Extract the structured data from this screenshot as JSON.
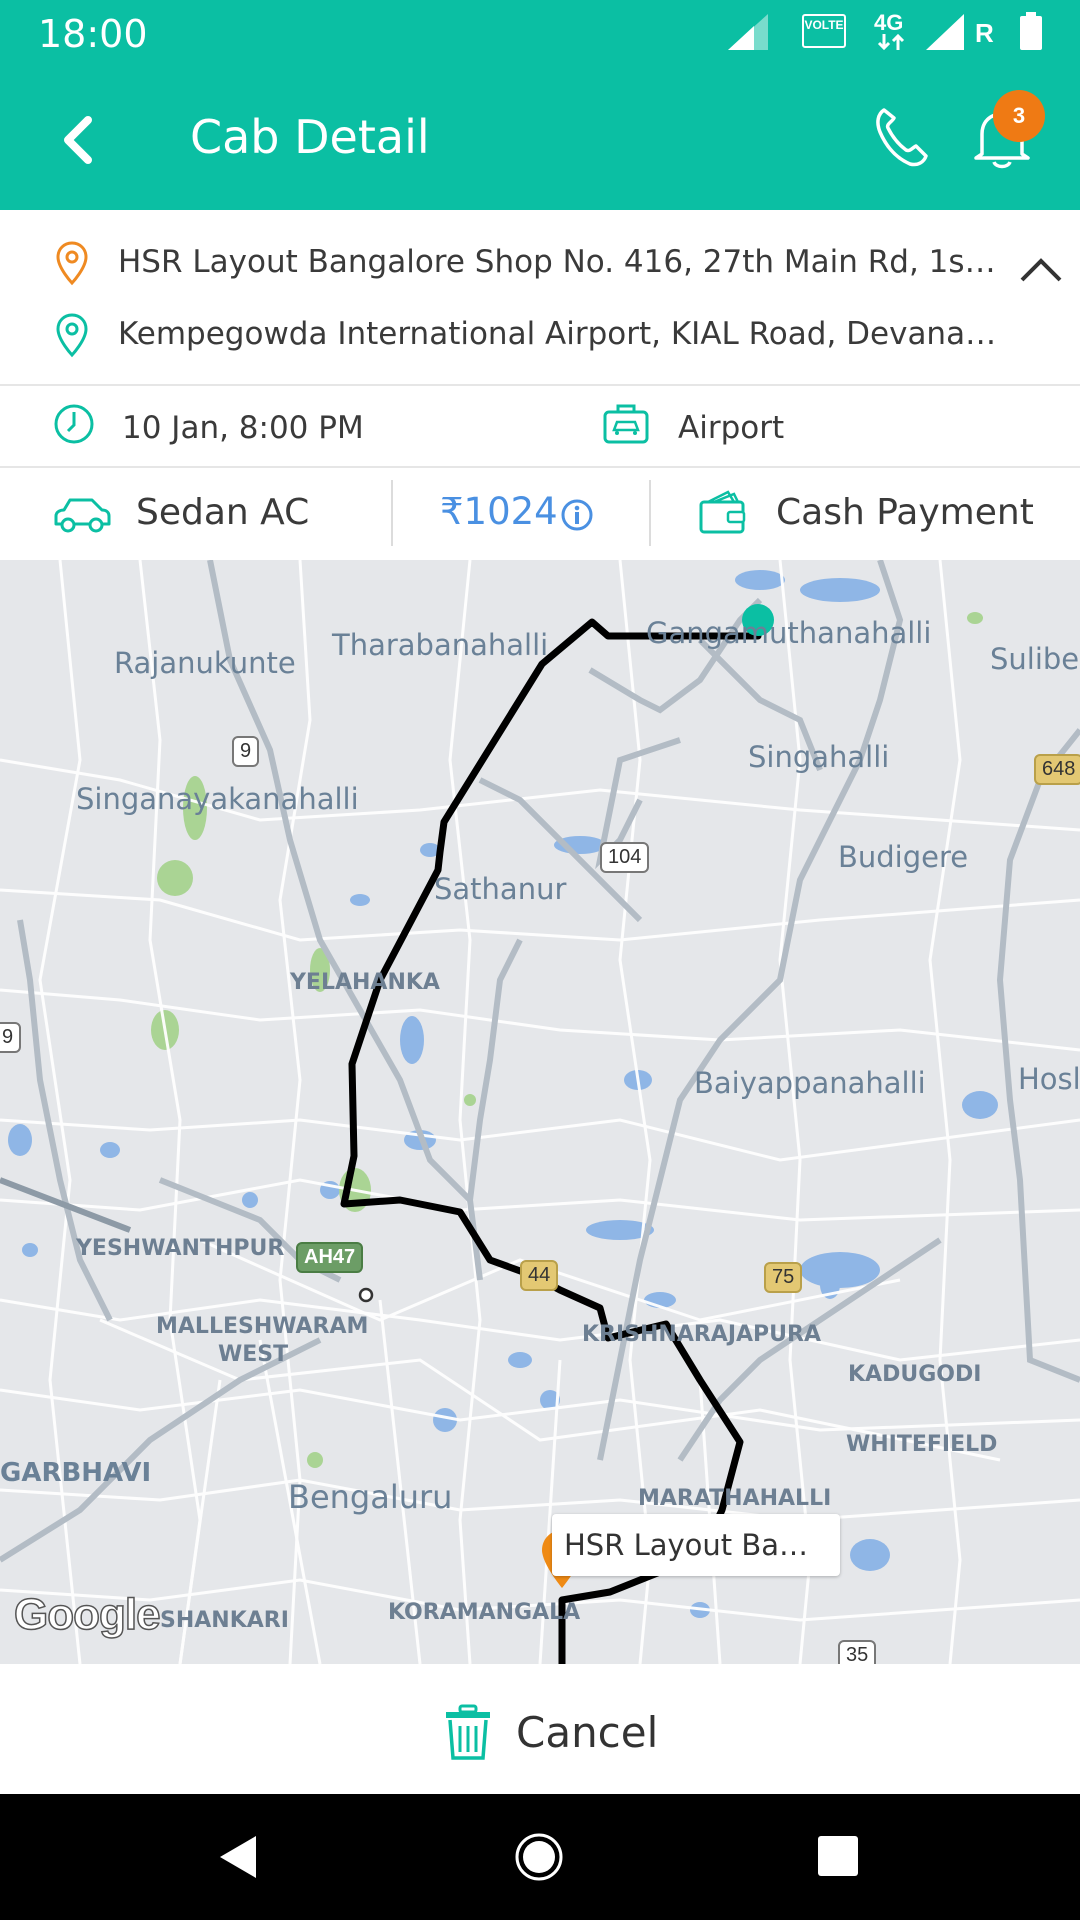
{
  "status_bar": {
    "time": "18:00",
    "volte_label": "VOLTE",
    "network_label": "4G",
    "roaming_label": "R"
  },
  "header": {
    "title": "Cab Detail",
    "notification_count": "3"
  },
  "addresses": {
    "pickup": "HSR Layout Bangalore Shop No. 416, 27th Main Rd, 1st…",
    "drop": "Kempegowda International Airport, KIAL Road, Devanaha…"
  },
  "trip": {
    "datetime": "10 Jan, 8:00 PM",
    "trip_type": "Airport"
  },
  "cab": {
    "type": "Sedan AC",
    "currency": "₹",
    "fare": "1024",
    "payment": "Cash Payment"
  },
  "map": {
    "places": [
      "Rajanukunte",
      "Tharabanahalli",
      "Gangamuthanahalli",
      "Sulibel",
      "Singahalli",
      "Singanayakanahalli",
      "Budigere",
      "Sathanur",
      "YELAHANKA",
      "Baiyappanahalli",
      "Hosl",
      "YESHWANTHPUR",
      "MALLESHWARAM",
      "WEST",
      "KRISHNARAJAPURA",
      "KADUGODI",
      "WHITEFIELD",
      "GARBHAVI",
      "Bengaluru",
      "MARATHAHALLI",
      "SHANKARI",
      "KORAMANGALA"
    ],
    "shields": [
      "9",
      "104",
      "648",
      "9",
      "AH47",
      "44",
      "75",
      "35"
    ],
    "marker_label": "HSR Layout Ba…",
    "attribution": "Google"
  },
  "footer": {
    "cancel_label": "Cancel"
  },
  "colors": {
    "primary": "#0bbfa3",
    "accent": "#ef7a14",
    "fare": "#4a90e2"
  }
}
